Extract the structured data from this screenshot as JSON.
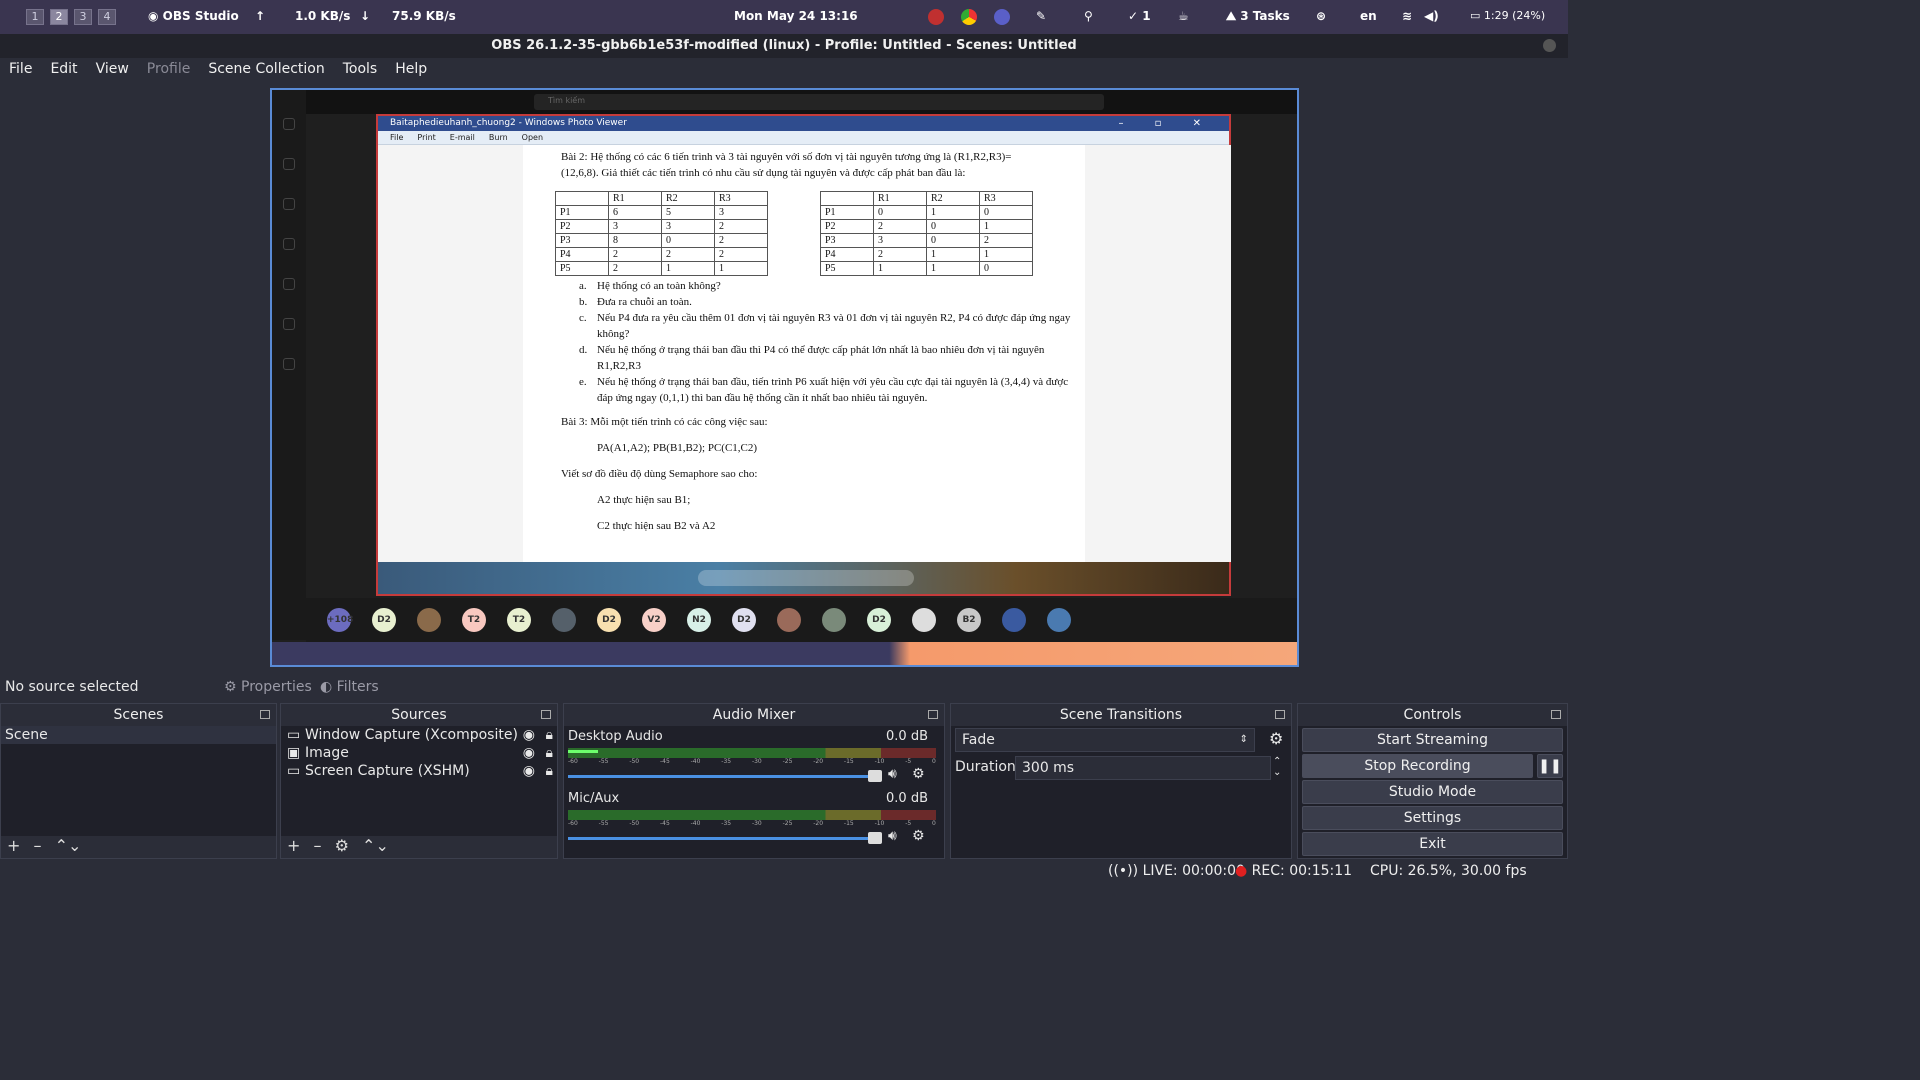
{
  "topbar": {
    "workspaces": [
      "1",
      "2",
      "3",
      "4"
    ],
    "app_name": "OBS Studio",
    "net_up": "1.0 KB/s",
    "net_down": "75.9 KB/s",
    "datetime": "Mon May 24  13:16",
    "checks": "1",
    "tasks": "3 Tasks",
    "lang": "en",
    "battery": "1:29 (24%)"
  },
  "window": {
    "title": "OBS 26.1.2-35-gbb6b1e53f-modified (linux) - Profile: Untitled - Scenes: Untitled"
  },
  "menu": {
    "file": "File",
    "edit": "Edit",
    "view": "View",
    "profile": "Profile",
    "scene_collection": "Scene Collection",
    "tools": "Tools",
    "help": "Help"
  },
  "preview": {
    "search_placeholder": "Tìm kiếm",
    "photo_title": "Baitaphedieuhanh_chuong2 - Windows Photo Viewer",
    "photo_menu": [
      "File",
      "Print",
      "E-mail",
      "Burn",
      "Open"
    ],
    "doc": {
      "bai2": "Bài 2: Hệ thống có các 6 tiến trình và 3 tài nguyên với số đơn vị tài nguyên tương ứng là (R1,R2,R3)=(12,6,8). Giả thiết các tiến trình có nhu cầu sử dụng tài nguyên và được cấp phát ban đầu là:",
      "headers": [
        "",
        "R1",
        "R2",
        "R3"
      ],
      "table1": [
        [
          "P1",
          "6",
          "5",
          "3"
        ],
        [
          "P2",
          "3",
          "3",
          "2"
        ],
        [
          "P3",
          "8",
          "0",
          "2"
        ],
        [
          "P4",
          "2",
          "2",
          "2"
        ],
        [
          "P5",
          "2",
          "1",
          "1"
        ]
      ],
      "table2": [
        [
          "P1",
          "0",
          "1",
          "0"
        ],
        [
          "P2",
          "2",
          "0",
          "1"
        ],
        [
          "P3",
          "3",
          "0",
          "2"
        ],
        [
          "P4",
          "2",
          "1",
          "1"
        ],
        [
          "P5",
          "1",
          "1",
          "0"
        ]
      ],
      "questions": [
        {
          "k": "a.",
          "t": "Hệ thống có an toàn không?"
        },
        {
          "k": "b.",
          "t": "Đưa ra chuỗi an toàn."
        },
        {
          "k": "c.",
          "t": "Nếu P4 đưa ra yêu cầu thêm 01 đơn vị tài nguyên R3 và 01 đơn vị tài nguyên R2, P4 có được đáp ứng ngay không?"
        },
        {
          "k": "d.",
          "t": "Nếu hệ thống ở trạng thái ban đầu thì P4 có thể được cấp phát lớn nhất là bao nhiêu đơn vị tài nguyên R1,R2,R3"
        },
        {
          "k": "e.",
          "t": "Nếu hệ thống ở trạng thái ban đầu, tiến trình P6 xuất hiện với yêu cầu cực đại tài nguyên là (3,4,4) và được đáp ứng ngay (0,1,1) thì ban đầu hệ thống cần ít nhất bao nhiêu tài nguyên."
        }
      ],
      "bai3": "Bài 3: Mỗi một tiến trình có các công việc sau:",
      "bai3_eq": "PA(A1,A2); PB(B1,B2); PC(C1,C2)",
      "bai3_req": "Viết sơ đồ điều độ dùng Semaphore sao cho:",
      "line1": "A2 thực hiện sau B1;",
      "line2": "C2 thực hiện sau B2 và A2"
    },
    "avatars": [
      {
        "t": "+108",
        "c": "#6c6cbf"
      },
      {
        "t": "D2",
        "c": "#e8f0d0"
      },
      {
        "t": "",
        "c": "#8a6a4a"
      },
      {
        "t": "T2",
        "c": "#f8c8c0"
      },
      {
        "t": "T2",
        "c": "#e8f0d0"
      },
      {
        "t": "",
        "c": "#55606a"
      },
      {
        "t": "D2",
        "c": "#f8e0b0"
      },
      {
        "t": "V2",
        "c": "#f8d0c8"
      },
      {
        "t": "N2",
        "c": "#d8f0e8"
      },
      {
        "t": "D2",
        "c": "#e0e0f0"
      },
      {
        "t": "",
        "c": "#9a6a5a"
      },
      {
        "t": "",
        "c": "#7a8a7a"
      },
      {
        "t": "D2",
        "c": "#d8f0d8"
      },
      {
        "t": "",
        "c": "#ddd"
      },
      {
        "t": "B2",
        "c": "#c8c8c8"
      },
      {
        "t": "",
        "c": "#3a5aa0"
      },
      {
        "t": "",
        "c": "#4a7ab0"
      }
    ]
  },
  "source_bar": {
    "no_source": "No source selected",
    "properties": "Properties",
    "filters": "Filters"
  },
  "scenes": {
    "title": "Scenes",
    "items": [
      "Scene"
    ]
  },
  "sources": {
    "title": "Sources",
    "items": [
      "Window Capture (Xcomposite)",
      "Image",
      "Screen Capture (XSHM)"
    ]
  },
  "mixer": {
    "title": "Audio Mixer",
    "channels": [
      {
        "name": "Desktop Audio",
        "db": "0.0 dB"
      },
      {
        "name": "Mic/Aux",
        "db": "0.0 dB"
      }
    ],
    "ticks": [
      "-60",
      "-55",
      "-50",
      "-45",
      "-40",
      "-35",
      "-30",
      "-25",
      "-20",
      "-15",
      "-10",
      "-5",
      "0"
    ]
  },
  "transitions": {
    "title": "Scene Transitions",
    "selected": "Fade",
    "duration_label": "Duration",
    "duration_value": "300 ms"
  },
  "controls": {
    "title": "Controls",
    "start_streaming": "Start Streaming",
    "stop_recording": "Stop Recording",
    "studio_mode": "Studio Mode",
    "settings": "Settings",
    "exit": "Exit"
  },
  "status": {
    "live": "LIVE: 00:00:00",
    "rec": "REC: 00:15:11",
    "cpu": "CPU: 26.5%, 30.00 fps"
  },
  "colors": {
    "accent": "#4a90e2",
    "rec": "#e02020",
    "topbar": "#3a3550"
  }
}
